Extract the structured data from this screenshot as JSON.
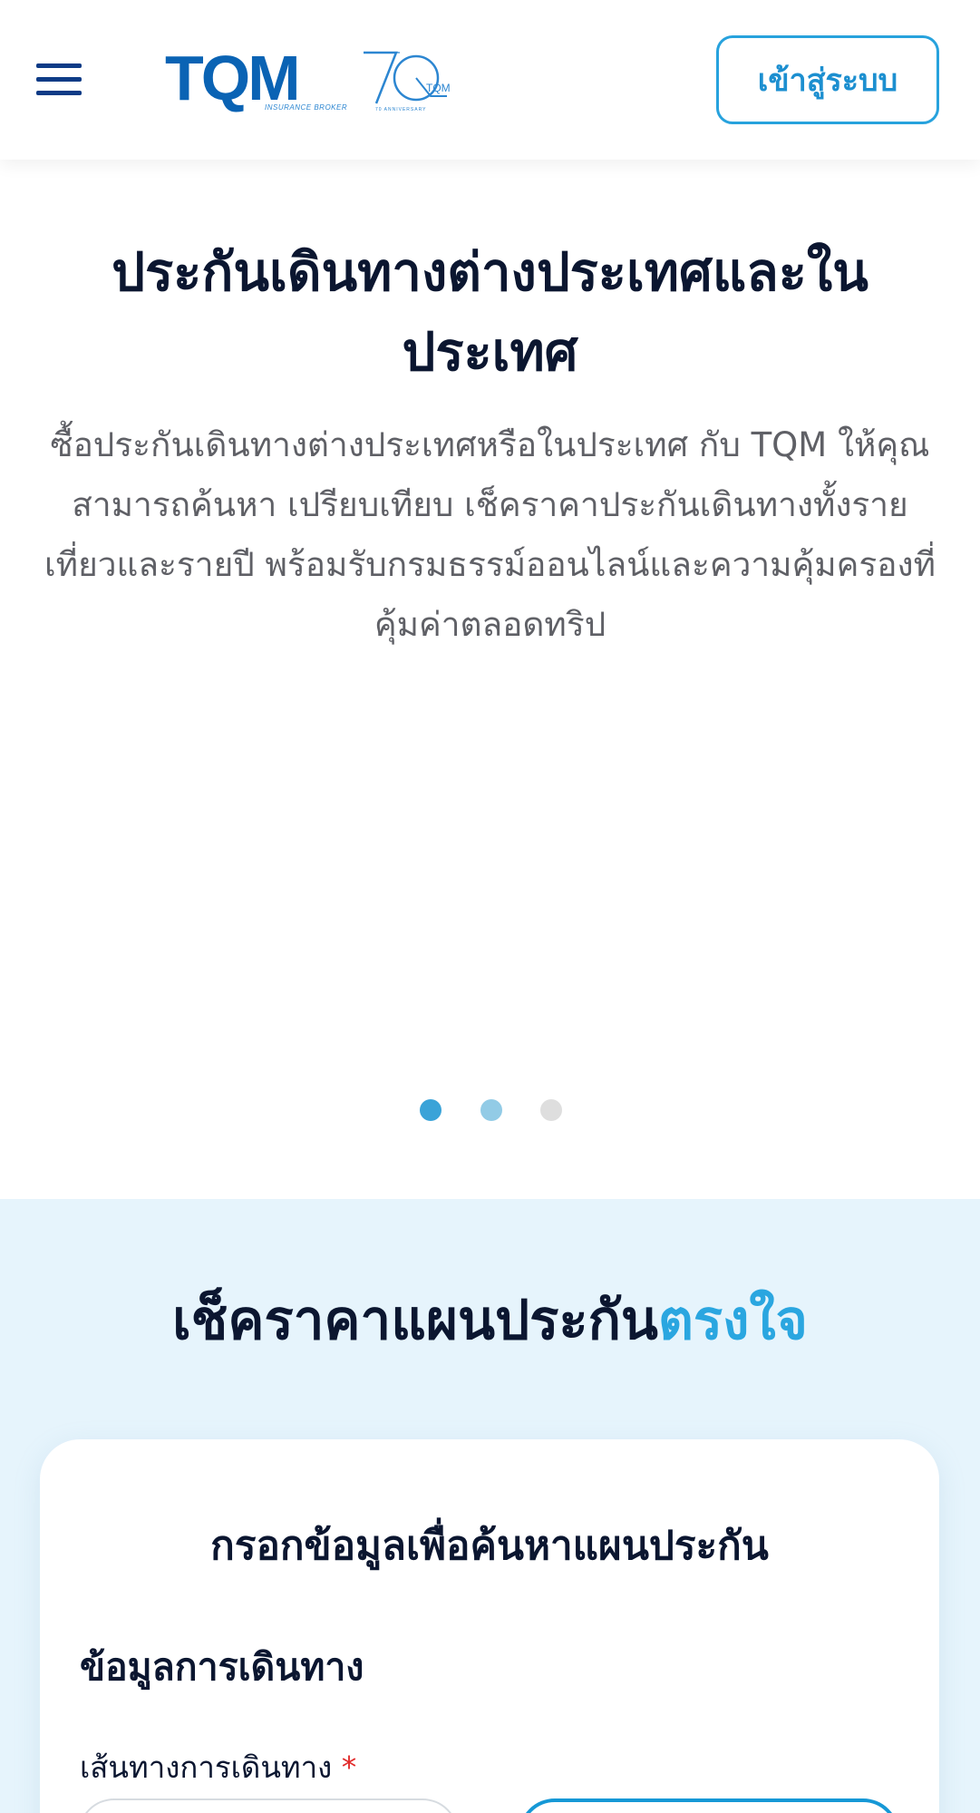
{
  "header": {
    "menu_icon": "hamburger-menu-icon",
    "logo_text": "TQM",
    "logo_subtext": "INSURANCE BROKER",
    "anniversary_logo_text": "70",
    "anniversary_logo_brand": "TQM",
    "anniversary_logo_subtext": "70 ANNIVERSARY",
    "login_label": "เข้าสู่ระบบ"
  },
  "hero": {
    "title": "ประกันเดินทางต่างประเทศและใน ประเทศ",
    "description": "ซื้อประกันเดินทางต่างประเทศหรือในประเทศ กับ TQM ให้คุณสามารถค้นหา เปรียบเทียบ เช็คราคาประกันเดินทางทั้งรายเที่ยวและรายปี พร้อมรับกรมธรรม์ออนไลน์และความคุ้มครองที่คุ้มค่าตลอดทริป",
    "carousel": {
      "slide_count": 3,
      "active_index": 0
    }
  },
  "check_price": {
    "title_main": "เช็คราคาแผนประกัน",
    "title_accent": "ตรงใจ",
    "form": {
      "title": "กรอกข้อมูลเพื่อค้นหาแผนประกัน",
      "section_label": "ข้อมูลการเดินทาง",
      "route_label": "เส้นทางการเดินทาง",
      "required_mark": "*"
    }
  },
  "colors": {
    "brand_blue": "#0a63b4",
    "accent_blue": "#2aa6e0",
    "section_bg": "#e6f4fc",
    "required_red": "#e12828"
  }
}
